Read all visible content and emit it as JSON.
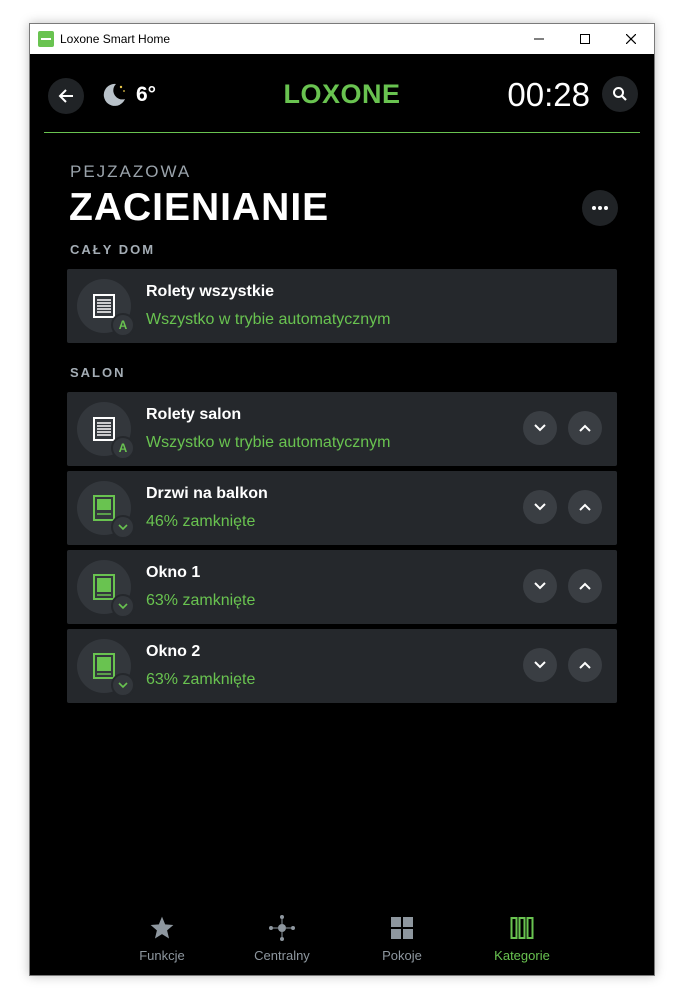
{
  "window": {
    "title": "Loxone Smart Home"
  },
  "header": {
    "weather_temp": "6°",
    "logo": "LOXONE",
    "clock": "00:28"
  },
  "page": {
    "subtitle": "PEJZAZOWA",
    "title": "ZACIENIANIE"
  },
  "sections": [
    {
      "label": "CAŁY DOM",
      "items": [
        {
          "name": "Rolety wszystkie",
          "status": "Wszystko w trybie automatycznym",
          "badge": "A"
        }
      ]
    },
    {
      "label": "SALON",
      "items": [
        {
          "name": "Rolety salon",
          "status": "Wszystko w trybie automatycznym",
          "badge": "A"
        },
        {
          "name": "Drzwi na balkon",
          "status": "46% zamknięte",
          "badge": "down"
        },
        {
          "name": "Okno 1",
          "status": "63% zamknięte",
          "badge": "down"
        },
        {
          "name": "Okno 2",
          "status": "63% zamknięte",
          "badge": "down"
        }
      ]
    }
  ],
  "bottom_nav": [
    {
      "label": "Funkcje",
      "icon": "star-icon"
    },
    {
      "label": "Centralny",
      "icon": "central-icon"
    },
    {
      "label": "Pokoje",
      "icon": "rooms-grid-icon"
    },
    {
      "label": "Kategorie",
      "icon": "categories-icon",
      "active": true
    }
  ],
  "colors": {
    "accent": "#69c350",
    "background": "#000000",
    "card": "#25282c",
    "muted_text": "#9aa3ab"
  }
}
